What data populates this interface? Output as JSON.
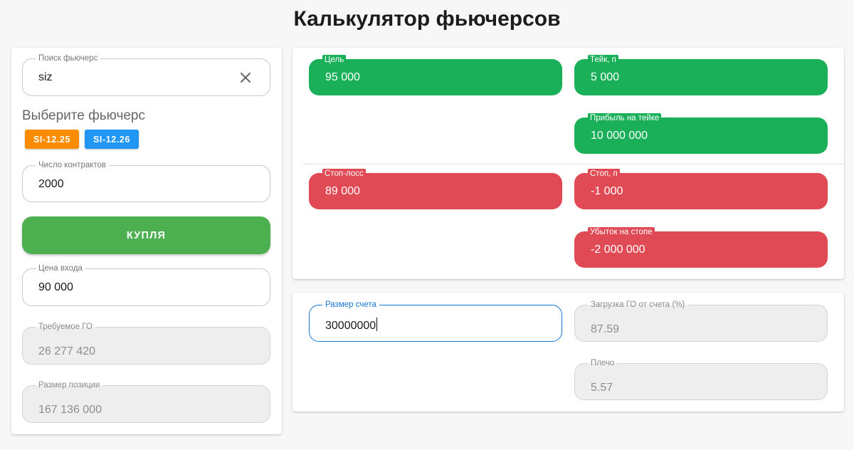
{
  "page": {
    "title": "Калькулятор фьючерсов"
  },
  "left_panel": {
    "search": {
      "label": "Поиск фьючерс",
      "value": "siz"
    },
    "select_heading": "Выберите фьючерс",
    "futures": [
      {
        "label": "SI-12.25",
        "color": "#fb8c00"
      },
      {
        "label": "SI-12.26",
        "color": "#2196f3"
      }
    ],
    "contracts": {
      "label": "Число контрактов",
      "value": "2000"
    },
    "buy_button": {
      "label": "КУПЛЯ",
      "color": "#4caf50"
    },
    "entry_price": {
      "label": "Цена входа",
      "value": "90 000"
    },
    "required_margin": {
      "label": "Требуемое ГО",
      "value": "26 277 420"
    },
    "position_size": {
      "label": "Размер позиции",
      "value": "167 136 000"
    }
  },
  "targets": {
    "target": {
      "label": "Цель",
      "value": "95 000"
    },
    "take_points": {
      "label": "Тейк, п",
      "value": "5 000"
    },
    "take_profit": {
      "label": "Прибыль на тейке",
      "value": "10 000 000"
    },
    "stop_loss": {
      "label": "Стоп-лосс",
      "value": "89 000"
    },
    "stop_points": {
      "label": "Стоп, п",
      "value": "-1 000"
    },
    "stop_loss_amount": {
      "label": "Убыток на стопе",
      "value": "-2 000 000"
    },
    "colors": {
      "profit": "#1ab05a",
      "loss": "#df4a54"
    }
  },
  "account": {
    "size": {
      "label": "Размер счета",
      "value": "30000000"
    },
    "margin_load": {
      "label": "Загрузка ГО от счета (%)",
      "value": "87.59"
    },
    "leverage": {
      "label": "Плечо",
      "value": "5.57"
    }
  }
}
